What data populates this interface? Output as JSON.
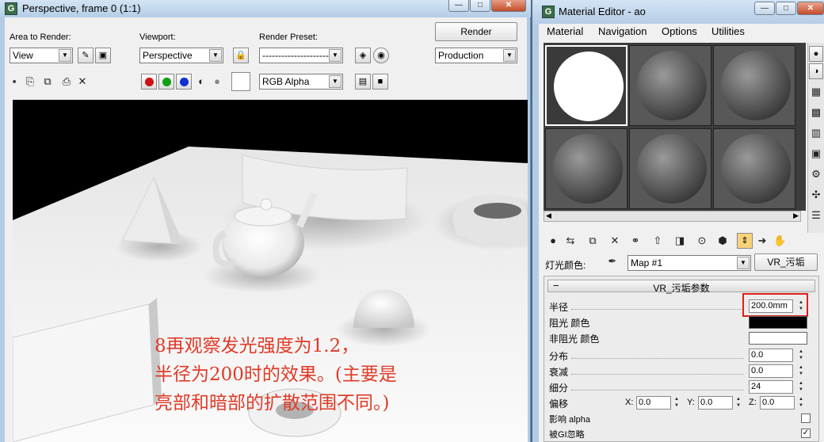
{
  "render_window": {
    "title": "Perspective, frame 0 (1:1)",
    "area_to_render_label": "Area to Render:",
    "area_to_render_value": "View",
    "viewport_label": "Viewport:",
    "viewport_value": "Perspective",
    "render_preset_label": "Render Preset:",
    "render_preset_value": "----------------------",
    "render_button": "Render",
    "production_value": "Production",
    "channel_value": "RGB Alpha",
    "caption_line1": "8再观察发光强度为1.2，",
    "caption_line2": "半径为200时的效果。(主要是",
    "caption_line3": "亮部和暗部的扩散范围不同。)"
  },
  "material_editor": {
    "title": "Material Editor - ao",
    "menu": [
      "Material",
      "Navigation",
      "Options",
      "Utilities"
    ],
    "light_color_label": "灯光颜色:",
    "map_name": "Map #1",
    "map_type": "VR_污垢",
    "rollout_title": "VR_污垢参数",
    "radius_label": "半径",
    "radius_value": "200.0mm",
    "occluded_label": "阻光 颜色",
    "unoccluded_label": "非阻光 颜色",
    "distribution_label": "分布",
    "distribution_value": "0.0",
    "falloff_label": "衰减",
    "falloff_value": "0.0",
    "subdivs_label": "细分",
    "subdivs_value": "24",
    "bias_label": "偏移",
    "bias_x_label": "X:",
    "bias_x_value": "0.0",
    "bias_y_label": "Y:",
    "bias_y_value": "0.0",
    "bias_z_label": "Z:",
    "bias_z_value": "0.0",
    "affect_alpha_label": "影响 alpha",
    "ignore_gi_label": "被GI忽略",
    "occluded_color": "#000000",
    "unoccluded_color": "#ffffff",
    "highlight_color": "#e0201a"
  }
}
